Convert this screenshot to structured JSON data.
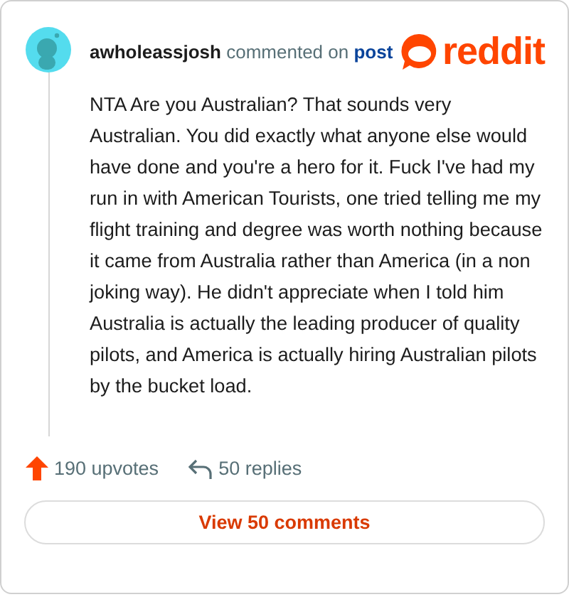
{
  "comment": {
    "author": "awholeassjosh",
    "action": "commented on",
    "link": "post",
    "body": "NTA Are you Australian? That sounds very Australian. You did exactly what anyone else would have done and you're a hero for it. Fuck I've had my run in with American Tourists, one tried telling me my flight training and degree was worth nothing because it came from Australia rather than America (in a non joking way). He didn't appreciate when I told him Australia is actually the leading producer of quality pilots, and America is actually hiring Australian pilots by the bucket load."
  },
  "logo": {
    "text": "reddit"
  },
  "stats": {
    "upvotes": "190 upvotes",
    "replies": "50 replies"
  },
  "button": "View 50 comments"
}
